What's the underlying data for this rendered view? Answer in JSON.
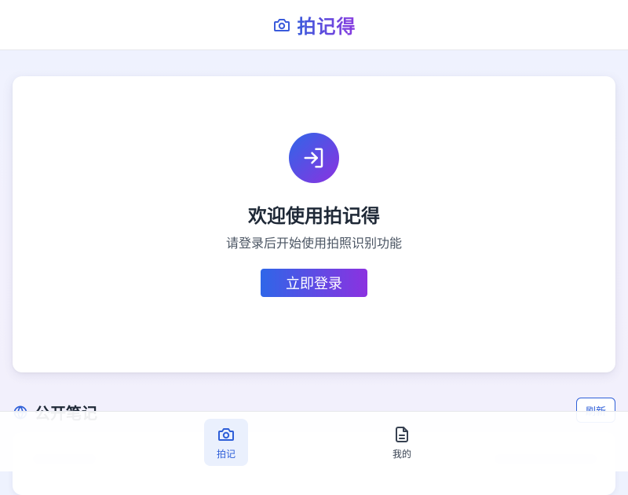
{
  "header": {
    "title": "拍记得",
    "logo_icon": "camera-icon",
    "accent_gradient": [
      "#3b5bdb",
      "#8a3be0"
    ]
  },
  "login_card": {
    "icon": "login-icon",
    "title": "欢迎使用拍记得",
    "subtitle": "请登录后开始使用拍照识别功能",
    "button_label": "立即登录"
  },
  "public_notes": {
    "icon": "globe-icon",
    "title": "公开笔记",
    "refresh_label": "刷新"
  },
  "bottom_nav": {
    "items": [
      {
        "label": "拍记",
        "icon": "camera-icon",
        "active": true
      },
      {
        "label": "我的",
        "icon": "document-icon",
        "active": false
      }
    ],
    "active_color": "#2f5fd8"
  }
}
